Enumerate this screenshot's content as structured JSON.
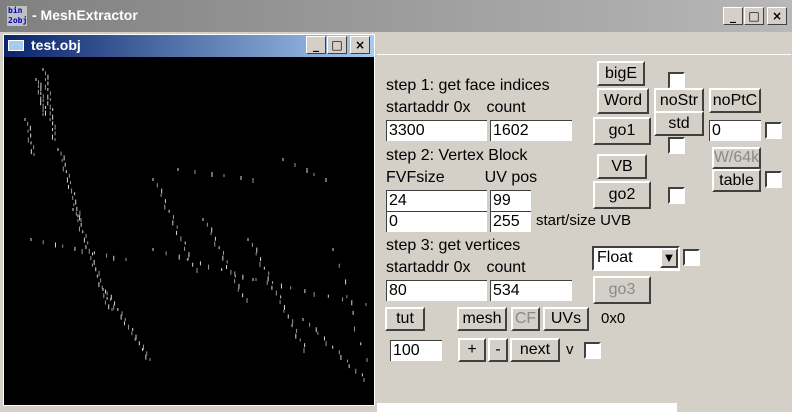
{
  "app": {
    "title": "- MeshExtractor",
    "icon_text": "bin 2obj",
    "controls": [
      "_",
      "□",
      "×"
    ]
  },
  "child_window": {
    "title": "test.obj",
    "controls": [
      "_",
      "□",
      "×"
    ]
  },
  "step1": {
    "heading": "step 1: get face indices",
    "startaddr_label": "startaddr 0x",
    "count_label": "count",
    "startaddr_value": "3300",
    "count_value": "1602"
  },
  "step2": {
    "heading": "step 2: Vertex Block",
    "fvf_label": "FVFsize",
    "uvpos_label": "UV pos",
    "fvf_value": "24",
    "uvpos_value": "99",
    "uvb_start_value": "0",
    "uvb_size_value": "255",
    "uvb_label": "start/size UVB"
  },
  "step3": {
    "heading": "step 3: get vertices",
    "startaddr_label": "startaddr 0x",
    "count_label": "count",
    "startaddr_value": "80",
    "count_value": "534",
    "format_selected": "Float"
  },
  "buttons": {
    "bigE": "bigE",
    "word": "Word",
    "nostr": "noStr",
    "noptc": "noPtC",
    "go1": "go1",
    "std": "std",
    "vb": "VB",
    "w64k": "W/64k",
    "go2": "go2",
    "table": "table",
    "go3": "go3",
    "tut": "tut",
    "mesh": "mesh",
    "cf": "CF",
    "uvs": "UVs",
    "plus": "+",
    "minus": "-",
    "next": "next"
  },
  "misc": {
    "noptc_value": "0",
    "hex_readout": "0x0",
    "step_value": "100",
    "v_label": "v"
  },
  "chart_data": {
    "type": "scatter",
    "title": "",
    "note": "faint white vertex points of the extracted mesh preview"
  }
}
